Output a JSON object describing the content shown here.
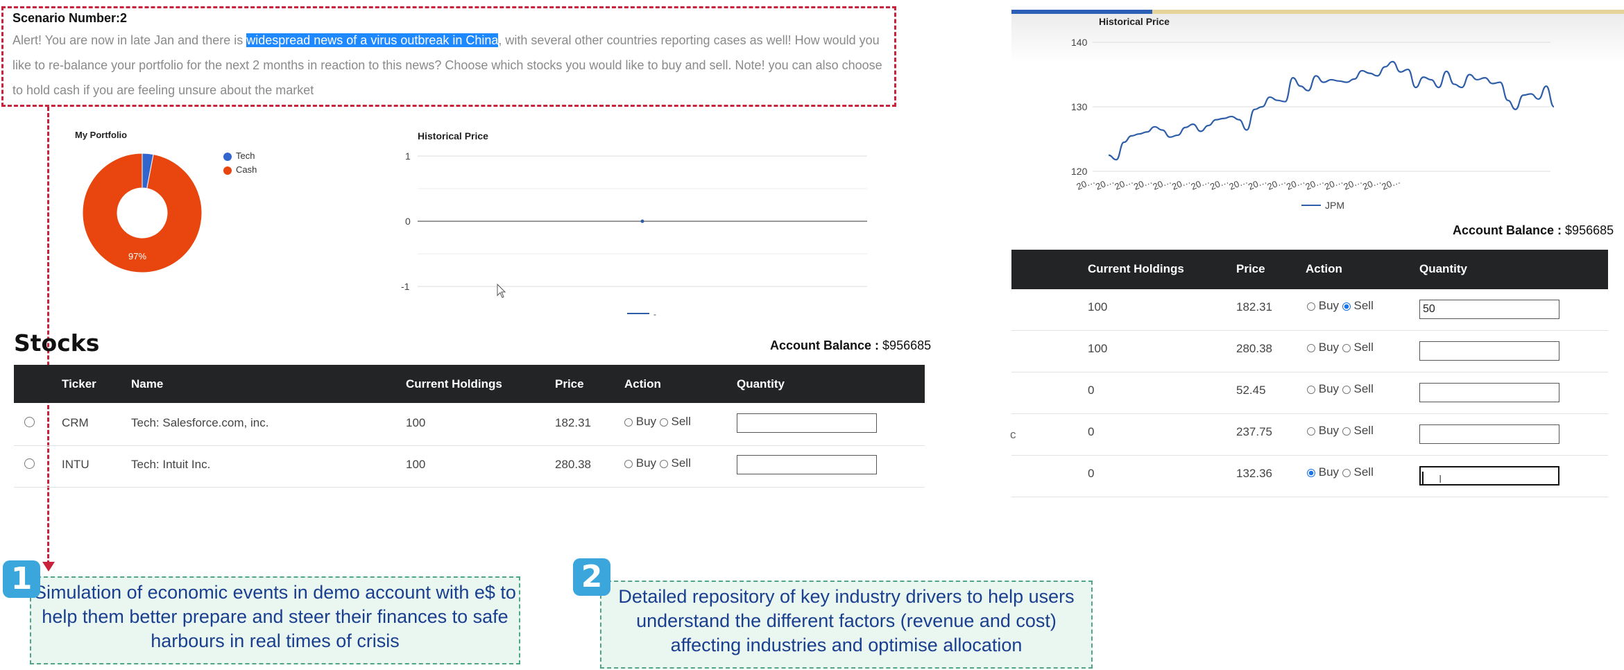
{
  "scenario": {
    "title": "Scenario Number:2",
    "text_before": "Alert! You are now in late Jan and there is ",
    "highlight": "widespread news of a virus outbreak in China",
    "text_after": ", with several other countries reporting cases as well! How would you like to re-balance your portfolio for the next 2 months in reaction to this news? Choose which stocks you would like to buy and sell. Note! you can also choose to hold cash if you are feeling unsure about the market"
  },
  "portfolio": {
    "title": "My Portfolio",
    "legend": [
      {
        "label": "Tech",
        "color": "#3366cc"
      },
      {
        "label": "Cash",
        "color": "#e8460e"
      }
    ],
    "slice_label": "97%"
  },
  "chart_data": [
    {
      "type": "pie",
      "title": "My Portfolio",
      "categories": [
        "Tech",
        "Cash"
      ],
      "values": [
        3,
        97
      ]
    },
    {
      "type": "line",
      "title": "Historical Price",
      "y_ticks": [
        "1",
        "0",
        "-1"
      ],
      "ylim": [
        -1,
        1
      ],
      "legend_label": "-",
      "series": [
        {
          "values": [
            0
          ]
        }
      ]
    },
    {
      "type": "line",
      "title": "Historical Price",
      "y_ticks": [
        "140",
        "130",
        "120"
      ],
      "ylim": [
        120,
        140
      ],
      "x_tick_labels": [
        "20…",
        "20…",
        "20…",
        "20…",
        "20…",
        "20…",
        "20…",
        "20…",
        "20…",
        "20…",
        "20…",
        "20…",
        "20…",
        "20…",
        "20…",
        "20…",
        "20…"
      ],
      "series": [
        {
          "name": "JPM",
          "values": [
            122.5,
            121.8,
            124.5,
            125.5,
            125.8,
            126.1,
            126.9,
            126.4,
            125.3,
            125.6,
            126.8,
            127.3,
            126.2,
            127.1,
            128.0,
            128.2,
            128.5,
            128.0,
            126.4,
            129.6,
            130.0,
            131.5,
            131.0,
            130.8,
            134.5,
            133.2,
            132.5,
            134.8,
            133.8,
            134.2,
            134.0,
            133.8,
            134.3,
            135.6,
            135.2,
            134.8,
            136.2,
            137.0,
            135.4,
            135.8,
            133.0,
            134.6,
            134.2,
            133.0,
            135.5,
            133.5,
            133.0,
            135.0,
            134.2,
            134.5,
            133.6,
            133.8,
            131.0,
            129.6,
            131.8,
            132.0,
            131.2,
            133.2,
            130.0
          ]
        }
      ]
    }
  ],
  "stocks_left": {
    "heading": "Stocks",
    "balance_label": "Account Balance : ",
    "balance_value": "$956685",
    "columns": [
      "Ticker",
      "Name",
      "Current Holdings",
      "Price",
      "Action",
      "Quantity"
    ],
    "buy_label": "Buy",
    "sell_label": "Sell",
    "rows": [
      {
        "ticker": "CRM",
        "name": "Tech: Salesforce.com, inc.",
        "holdings": "100",
        "price": "182.31",
        "qty": ""
      },
      {
        "ticker": "INTU",
        "name": "Tech: Intuit Inc.",
        "holdings": "100",
        "price": "280.38",
        "qty": ""
      }
    ]
  },
  "stocks_right": {
    "balance_label": "Account Balance : ",
    "balance_value": "$956685",
    "columns": [
      "Current Holdings",
      "Price",
      "Action",
      "Quantity"
    ],
    "buy_label": "Buy",
    "sell_label": "Sell",
    "row4_prefix": "c",
    "rows": [
      {
        "holdings": "100",
        "price": "182.31",
        "action": "sell",
        "qty": "50"
      },
      {
        "holdings": "100",
        "price": "280.38",
        "action": "none",
        "qty": ""
      },
      {
        "holdings": "0",
        "price": "52.45",
        "action": "none",
        "qty": ""
      },
      {
        "holdings": "0",
        "price": "237.75",
        "action": "none",
        "qty": ""
      },
      {
        "holdings": "0",
        "price": "132.36",
        "action": "buy",
        "qty": ""
      }
    ]
  },
  "callouts": [
    {
      "number": "1",
      "text": "Simulation of economic events in demo account with e$ to help them better prepare and steer their finances to safe harbours in real times of crisis"
    },
    {
      "number": "2",
      "text": "Detailed repository of key industry drivers to help users understand the different factors (revenue and cost) affecting industries and optimise allocation"
    }
  ],
  "colors": {
    "accent_red": "#c8233a",
    "tech": "#3366cc",
    "cash": "#e8460e",
    "line": "#2f5ea8",
    "badge": "#3aa6dc",
    "callout_text": "#1a3f8f"
  }
}
